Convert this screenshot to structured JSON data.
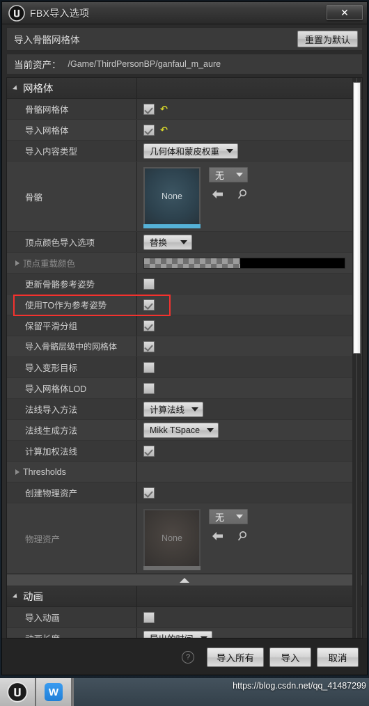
{
  "window": {
    "title": "FBX导入选项",
    "logo_icon": "unreal-engine-logo",
    "close_icon": "close-icon",
    "close_glyph": "✕"
  },
  "subheader": {
    "label": "导入骨骼网格体",
    "reset_label": "重置为默认"
  },
  "asset": {
    "label": "当前资产：",
    "path": "/Game/ThirdPersonBP/ganfaul_m_aure"
  },
  "sections": [
    {
      "id": "mesh",
      "title": "网格体",
      "rows": [
        {
          "name": "骨骼网格体",
          "type": "checkbox",
          "checked": true,
          "reset": true,
          "stripe": "plain"
        },
        {
          "name": "导入网格体",
          "type": "checkbox",
          "checked": true,
          "reset": true,
          "stripe": "alt"
        },
        {
          "name": "导入内容类型",
          "type": "combo",
          "value": "几何体和蒙皮权重",
          "stripe": "plain"
        },
        {
          "name": "骨骼",
          "type": "picker",
          "thumb": "None",
          "value": "无",
          "variant": "blue",
          "stripe": "alt"
        },
        {
          "name": "顶点颜色导入选项",
          "type": "combo",
          "value": "替换",
          "stripe": "plain"
        },
        {
          "name": "顶点重载颜色",
          "type": "color",
          "expandable": true,
          "dim": true,
          "stripe": "alt"
        },
        {
          "name": "更新骨骼参考姿势",
          "type": "checkbox",
          "checked": false,
          "stripe": "plain"
        },
        {
          "name": "使用TO作为参考姿势",
          "type": "checkbox",
          "checked": true,
          "stripe": "alt",
          "highlight": true
        },
        {
          "name": "保留平滑分组",
          "type": "checkbox",
          "checked": true,
          "stripe": "plain"
        },
        {
          "name": "导入骨骼层级中的网格体",
          "type": "checkbox",
          "checked": true,
          "stripe": "alt",
          "wide": true
        },
        {
          "name": "导入变形目标",
          "type": "checkbox",
          "checked": false,
          "stripe": "plain"
        },
        {
          "name": "导入网格体LOD",
          "type": "checkbox",
          "checked": false,
          "stripe": "alt"
        },
        {
          "name": "法线导入方法",
          "type": "combo",
          "value": "计算法线",
          "stripe": "plain"
        },
        {
          "name": "法线生成方法",
          "type": "combo",
          "value": "Mikk TSpace",
          "stripe": "alt"
        },
        {
          "name": "计算加权法线",
          "type": "checkbox",
          "checked": true,
          "stripe": "plain"
        },
        {
          "name": "Thresholds",
          "type": "group",
          "expandable": true,
          "stripe": "alt"
        },
        {
          "name": "创建物理资产",
          "type": "checkbox",
          "checked": true,
          "stripe": "plain"
        },
        {
          "name": "物理资产",
          "type": "picker",
          "thumb": "None",
          "value": "无",
          "variant": "gray",
          "dim": true,
          "stripe": "alt"
        }
      ]
    },
    {
      "id": "animation",
      "title": "动画",
      "rows": [
        {
          "name": "导入动画",
          "type": "checkbox",
          "checked": false,
          "stripe": "plain"
        },
        {
          "name": "动画长度",
          "type": "combo",
          "value": "导出的时间",
          "stripe": "alt",
          "clipped": true
        }
      ]
    }
  ],
  "icons": {
    "expand_triangle": "chevron-right-icon",
    "collapse_strip": "collapse-up-icon",
    "back_arrow": "back-arrow-icon",
    "browse": "search-icon",
    "reset_arrow": "reset-arrow-icon"
  },
  "footer": {
    "help_glyph": "?",
    "buttons": [
      {
        "label": "导入所有",
        "name": "import-all-button"
      },
      {
        "label": "导入",
        "name": "import-button"
      },
      {
        "label": "取消",
        "name": "cancel-button"
      }
    ]
  },
  "taskbar": {
    "items": [
      {
        "name": "taskbar-unreal-engine",
        "icon": "unreal-engine-logo"
      },
      {
        "name": "taskbar-wps",
        "icon": "wps-icon",
        "glyph": "W"
      }
    ],
    "watermark": "https://blog.csdn.net/qq_41487299"
  },
  "colors": {
    "highlight": "#f4322e",
    "accent_blue": "#55b2d8",
    "reset_yellow": "#d6d62a"
  }
}
